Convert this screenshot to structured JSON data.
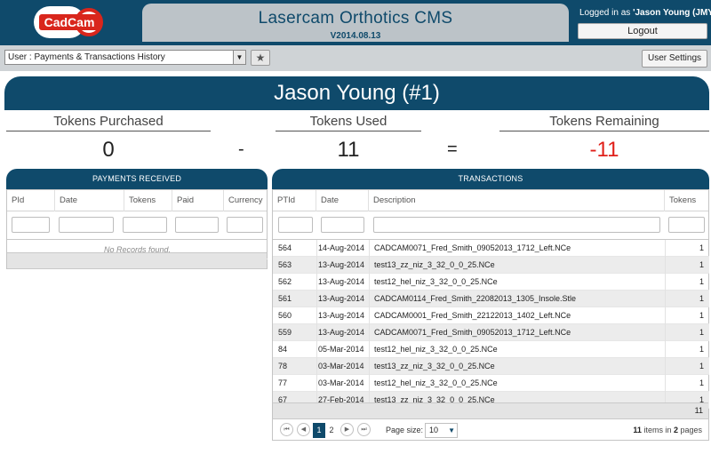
{
  "header": {
    "logo_text": "CadCam",
    "title": "Lasercam Orthotics CMS",
    "version": "V2014.08.13",
    "login_prefix": "Logged in as ",
    "login_user": "'Jason Young (JMY)'",
    "logout_label": "Logout"
  },
  "toolbar": {
    "page_select_value": "User : Payments & Transactions History",
    "star_glyph": "★",
    "settings_label": "User Settings"
  },
  "user": {
    "name": "Jason Young (#1)"
  },
  "tokens": {
    "purchased_label": "Tokens Purchased",
    "purchased_value": "0",
    "used_label": "Tokens Used",
    "used_value": "11",
    "remaining_label": "Tokens Remaining",
    "remaining_value": "-11",
    "minus_sign": "-",
    "equals_sign": "="
  },
  "payments": {
    "title": "PAYMENTS RECEIVED",
    "columns": [
      "PId",
      "Date",
      "Tokens",
      "Paid",
      "Currency"
    ],
    "no_records": "No Records found."
  },
  "transactions": {
    "title": "TRANSACTIONS",
    "columns": [
      "PTId",
      "Date",
      "Description",
      "Tokens"
    ],
    "rows": [
      {
        "id": "564",
        "date": "14-Aug-2014",
        "desc": "CADCAM0071_Fred_Smith_09052013_1712_Left.NCe",
        "tokens": "1"
      },
      {
        "id": "563",
        "date": "13-Aug-2014",
        "desc": "test13_zz_niz_3_32_0_0_25.NCe",
        "tokens": "1"
      },
      {
        "id": "562",
        "date": "13-Aug-2014",
        "desc": "test12_hel_niz_3_32_0_0_25.NCe",
        "tokens": "1"
      },
      {
        "id": "561",
        "date": "13-Aug-2014",
        "desc": "CADCAM0114_Fred_Smith_22082013_1305_Insole.Stle",
        "tokens": "1"
      },
      {
        "id": "560",
        "date": "13-Aug-2014",
        "desc": "CADCAM0001_Fred_Smith_22122013_1402_Left.NCe",
        "tokens": "1"
      },
      {
        "id": "559",
        "date": "13-Aug-2014",
        "desc": "CADCAM0071_Fred_Smith_09052013_1712_Left.NCe",
        "tokens": "1"
      },
      {
        "id": "84",
        "date": "05-Mar-2014",
        "desc": "test12_hel_niz_3_32_0_0_25.NCe",
        "tokens": "1"
      },
      {
        "id": "78",
        "date": "03-Mar-2014",
        "desc": "test13_zz_niz_3_32_0_0_25.NCe",
        "tokens": "1"
      },
      {
        "id": "77",
        "date": "03-Mar-2014",
        "desc": "test12_hel_niz_3_32_0_0_25.NCe",
        "tokens": "1"
      },
      {
        "id": "67",
        "date": "27-Feb-2014",
        "desc": "test13_zz_niz_3_32_0_0_25.NCe",
        "tokens": "1"
      }
    ],
    "footer_total": "11"
  },
  "pager": {
    "first_glyph": "⏮",
    "prev_glyph": "◀",
    "next_glyph": "▶",
    "last_glyph": "⏭",
    "page1": "1",
    "page2": "2",
    "page_size_label": "Page size:",
    "page_size_value": "10",
    "items_count": "11",
    "items_mid": " items in ",
    "pages_count": "2",
    "pages_suffix": " pages"
  },
  "colors": {
    "primary": "#0f4a6b",
    "negative": "#e0201a"
  }
}
